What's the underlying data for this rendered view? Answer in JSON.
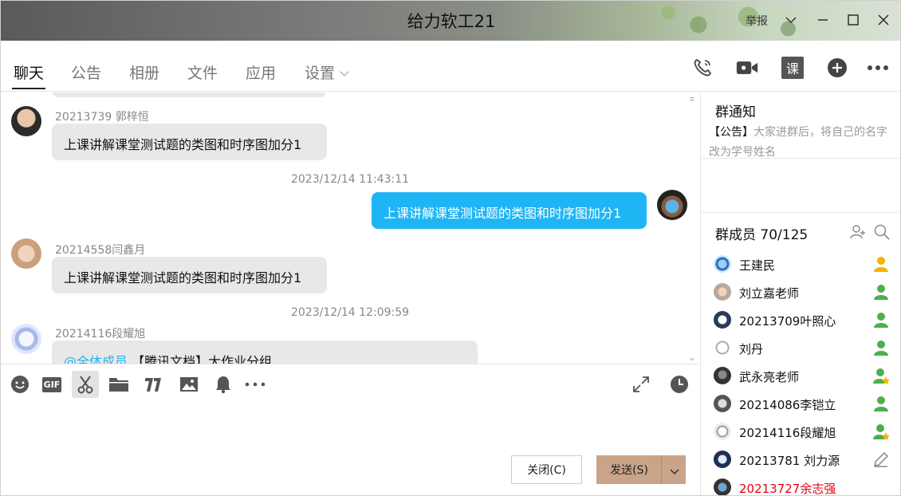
{
  "window": {
    "title": "给力软工21",
    "report_label": "举报"
  },
  "tabs": [
    {
      "label": "聊天"
    },
    {
      "label": "公告"
    },
    {
      "label": "相册"
    },
    {
      "label": "文件"
    },
    {
      "label": "应用"
    },
    {
      "label": "设置"
    }
  ],
  "header_icons": [
    "phone-icon",
    "video-call-icon",
    "lesson-icon",
    "add-circle-icon",
    "more-icon"
  ],
  "header_lesson_glyph": "课",
  "chat": {
    "messages": [
      {
        "sender": "20213739 郭梓恒",
        "text": "上课讲解课堂测试题的类图和时序图加分1",
        "mine": false
      },
      {
        "timestamp": "2023/12/14 11:43:11"
      },
      {
        "text": "上课讲解课堂测试题的类图和时序图加分1",
        "mine": true
      },
      {
        "sender": "20214558闫鑫月",
        "text": "上课讲解课堂测试题的类图和时序图加分1",
        "mine": false
      },
      {
        "timestamp": "2023/12/14 12:09:59"
      },
      {
        "sender": "20214116段耀旭",
        "mention": "@全体成员",
        "text": "【腾讯文档】大作业分组",
        "mine": false
      }
    ]
  },
  "toolbar": {
    "icons": [
      "emoji-icon",
      "gif-icon",
      "scissors-icon",
      "folder-icon",
      "font-icon",
      "image-icon",
      "bell-icon",
      "more-icon",
      "expand-icon",
      "history-clock-icon"
    ],
    "gif_label": "GIF"
  },
  "buttons": {
    "close_label": "关闭(C)",
    "send_label": "发送(S)"
  },
  "notice": {
    "title": "群通知",
    "tag": "【公告】",
    "text": "大家进群后，将自己的名字改为学号姓名"
  },
  "members": {
    "title": "群成员 70/125",
    "list": [
      {
        "name": "王建民",
        "role": "owner",
        "highlight": false
      },
      {
        "name": "刘立嘉老师",
        "role": "member",
        "highlight": false
      },
      {
        "name": "20213709叶照心",
        "role": "member",
        "highlight": false
      },
      {
        "name": "刘丹",
        "role": "member",
        "highlight": false
      },
      {
        "name": "武永亮老师",
        "role": "admin",
        "highlight": false
      },
      {
        "name": "20214086李铠立",
        "role": "member",
        "highlight": false
      },
      {
        "name": "20214116段耀旭",
        "role": "admin",
        "highlight": false
      },
      {
        "name": "20213781 刘力源",
        "role": "edit",
        "highlight": false
      },
      {
        "name": "20213727余志强",
        "role": "none",
        "highlight": true
      }
    ]
  },
  "colors": {
    "my_bubble": "#1fb5f4",
    "other_bubble": "#e8e8e8",
    "send_button": "#c9a488",
    "member_owner": "#f4b400",
    "member_normal": "#4caf50",
    "highlight_name": "#e60012",
    "mention": "#1fb5f4"
  }
}
